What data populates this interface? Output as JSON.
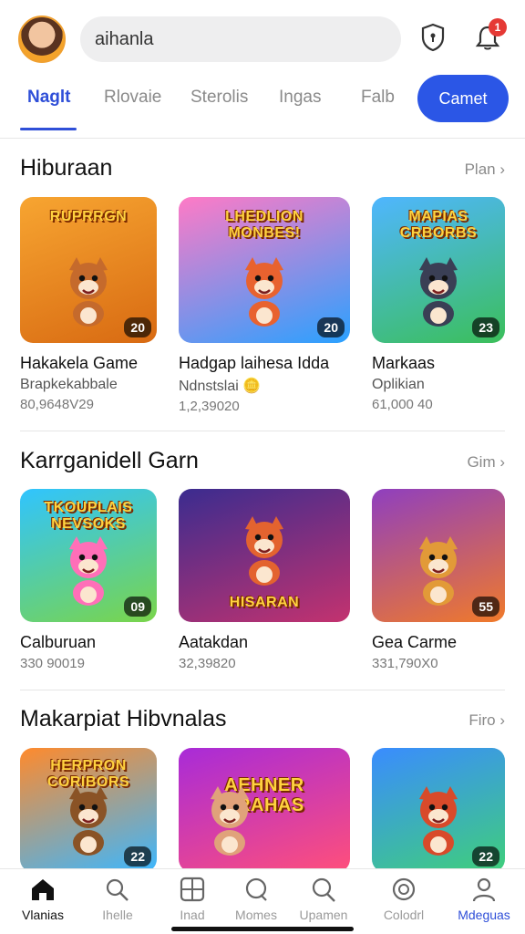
{
  "header": {
    "search_value": "aihanla",
    "notification_count": "1",
    "avatar_icon": "user-avatar",
    "shield_icon": "shield-icon",
    "bell_icon": "bell-icon"
  },
  "tabs": [
    {
      "label": "Naglt"
    },
    {
      "label": "Rlovaie"
    },
    {
      "label": "Sterolis"
    },
    {
      "label": "Ingas"
    },
    {
      "label": "Falb"
    },
    {
      "label": "Camet"
    }
  ],
  "sections": [
    {
      "title": "Hiburaan",
      "more": "Plan ›",
      "cards": [
        {
          "banner": "RUPRRGN",
          "title": "Hakakela Game",
          "sub": "Brapkekabbale",
          "count": "80,9648V29",
          "rating": "20",
          "bg": [
            "#f7a531",
            "#d86a12"
          ],
          "mascot": "#c56a2c"
        },
        {
          "banner": "LHEDLION MONBES!",
          "title": "Hadgap laihesa Idda",
          "sub": "Ndnstslai 🪙",
          "count": "1,2,39020",
          "rating": "20",
          "bg": [
            "#ff7ac6",
            "#2aa1ff"
          ],
          "mascot": "#e8622f"
        },
        {
          "banner": "MAPIAS CRBORBS",
          "title": "Markaas",
          "sub": "Oplikian",
          "count": "61,000 40",
          "rating": "23",
          "bg": [
            "#4fb6ff",
            "#3bbf5a"
          ],
          "mascot": "#3a3f55"
        }
      ]
    },
    {
      "title": "Karrganidell Garn",
      "more": "Gim ›",
      "cards": [
        {
          "banner": "TKOUPLAIS NEVSOKS",
          "title": "Calburuan",
          "sub": "",
          "count": "330 90019",
          "rating": "09",
          "bg": [
            "#30c4ff",
            "#7ad54a"
          ],
          "mascot": "#ff6fb8"
        },
        {
          "banner": "HISARAN",
          "title": "Aatakdan",
          "sub": "",
          "count": "32,39820",
          "rating": "",
          "bg": [
            "#3b2c8f",
            "#c3326f"
          ],
          "mascot": "#e3632f"
        },
        {
          "banner": "",
          "title": "Gea Carme",
          "sub": "",
          "count": "331,790X0",
          "rating": "55",
          "bg": [
            "#8f3fbf",
            "#f07a2a"
          ],
          "mascot": "#e29a38"
        }
      ]
    },
    {
      "title": "Makarpiat Hibvnalas",
      "more": "Firo ›",
      "cards": [
        {
          "banner": "HERPRON CORIBORS",
          "title": "",
          "sub": "",
          "count": "",
          "rating": "22",
          "bg": [
            "#ff8a2c",
            "#3bb7ff"
          ],
          "mascot": "#8a5326"
        },
        {
          "banner": "AEHNER SRAHAS",
          "title": "",
          "sub": "",
          "count": "",
          "rating": "",
          "bg": [
            "#a82bd8",
            "#ff4f7b"
          ],
          "mascot": "#e0a27a"
        },
        {
          "banner": "",
          "title": "",
          "sub": "",
          "count": "",
          "rating": "22",
          "bg": [
            "#3a8cff",
            "#3fcf7a"
          ],
          "mascot": "#d84a2a"
        }
      ]
    }
  ],
  "bottom_nav": [
    {
      "label": "Vlanias",
      "icon": "home-icon"
    },
    {
      "label": "Ihelle",
      "icon": "search-person-icon"
    },
    {
      "label": "Inad",
      "icon": "grid-icon"
    },
    {
      "label": "Momes",
      "icon": "search-icon"
    },
    {
      "label": "Upamen",
      "icon": "search-alt-icon"
    },
    {
      "label": "Colodrl",
      "icon": "controller-icon"
    },
    {
      "label": "Mdeguas",
      "icon": "profile-icon"
    }
  ],
  "colors": {
    "accent": "#2b56e6",
    "active_tab": "#2f4fd8"
  }
}
